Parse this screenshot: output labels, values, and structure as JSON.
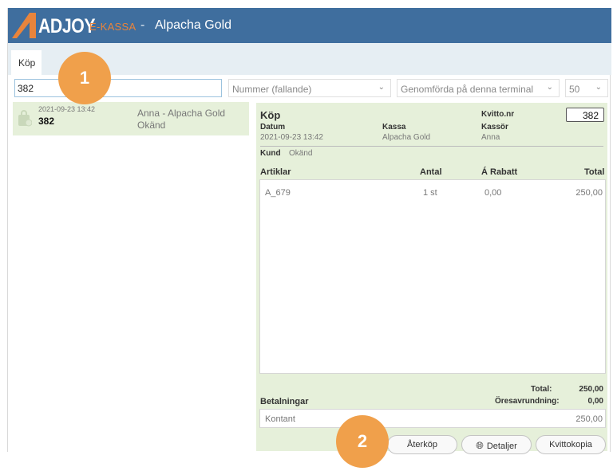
{
  "header": {
    "logo_text": "ADJOY",
    "logo_sub": "E-KASSA",
    "separator": "-",
    "store_name": "Alpacha Gold",
    "brand_color": "#3f6e9e",
    "accent_color": "#e8843c"
  },
  "tabs": [
    {
      "label": "Köp"
    }
  ],
  "filters": {
    "search_value": "382",
    "sort": "Nummer (fallande)",
    "scope": "Genomförda på denna terminal",
    "page_size": "50"
  },
  "list": [
    {
      "date": "2021-09-23 13:42",
      "number": "382",
      "name": "Anna - Alpacha Gold",
      "customer": "Okänd",
      "icon": "shopping-bag-icon"
    }
  ],
  "detail": {
    "title": "Köp",
    "kvitto_label": "Kvitto.nr",
    "kvitto_value": "382",
    "datum_label": "Datum",
    "datum_value": "2021-09-23 13:42",
    "kassa_label": "Kassa",
    "kassa_value": "Alpacha Gold",
    "kassor_label": "Kassör",
    "kassor_value": "Anna",
    "kund_label": "Kund",
    "kund_value": "Okänd",
    "columns": {
      "artiklar": "Artiklar",
      "antal": "Antal",
      "rabatt": "Á Rabatt",
      "total": "Total"
    },
    "rows": [
      {
        "article": "A_679",
        "qty": "1 st",
        "discount": "0,00",
        "total": "250,00"
      }
    ],
    "total_label": "Total:",
    "total_value": "250,00",
    "rounding_label": "Öresavrundning:",
    "rounding_value": "0,00",
    "payments_label": "Betalningar",
    "payments": [
      {
        "method": "Kontant",
        "amount": "250,00"
      }
    ],
    "buttons": {
      "aterkop": "Återköp",
      "detaljer": "Detaljer",
      "kvittokopia": "Kvittokopia"
    }
  },
  "annotations": {
    "badge1": "1",
    "badge2": "2",
    "badge_color": "#f0a04b"
  }
}
